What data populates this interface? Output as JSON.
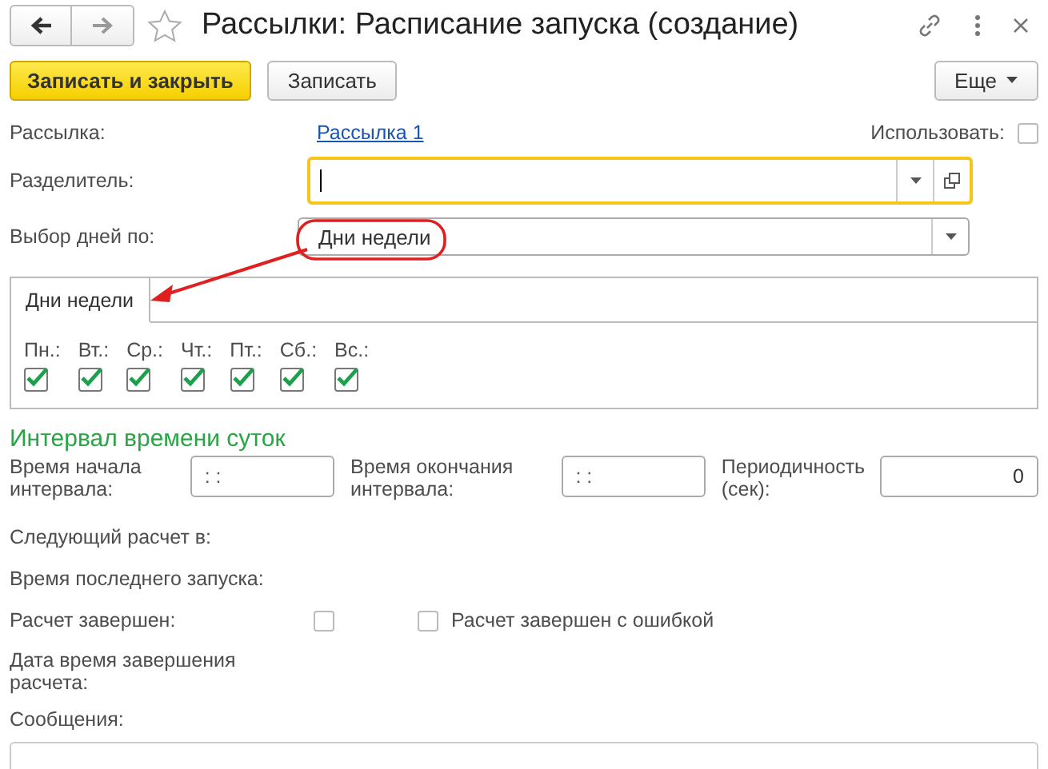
{
  "window": {
    "title": "Рассылки: Расписание запуска (создание)",
    "favorite": false
  },
  "toolbar": {
    "buttons": [
      {
        "label": "Записать и закрыть",
        "kind": "primary"
      },
      {
        "label": "Записать",
        "kind": "normal"
      }
    ],
    "more": "Еще"
  },
  "mailing": {
    "label": "Рассылка:",
    "link": "Рассылка 1",
    "use_label": "Использовать:",
    "use_checked": false
  },
  "separator": {
    "label": "Разделитель:",
    "focused": true
  },
  "days_by": {
    "label": "Выбор дней по:",
    "value": "Дни недели"
  },
  "tabs": [
    {
      "label": "Дни недели",
      "selected": true
    }
  ],
  "days": [
    {
      "label": "Пн.:",
      "checked": true
    },
    {
      "label": "Вт.:",
      "checked": true
    },
    {
      "label": "Ср.:",
      "checked": true
    },
    {
      "label": "Чт.:",
      "checked": true
    },
    {
      "label": "Пт.:",
      "checked": true
    },
    {
      "label": "Сб.:",
      "checked": true
    },
    {
      "label": "Вс.:",
      "checked": true
    }
  ],
  "interval": {
    "heading": "Интервал времени суток",
    "start_label": "Время начала интервала:",
    "start_value": ":  :",
    "end_label": "Время окончания интервала:",
    "end_value": ":  :",
    "period_label": "Периодичность (сек):",
    "period_value": "0"
  },
  "next_run_label": "Следующий расчет в:",
  "last_run_label": "Время последнего запуска:",
  "done": {
    "label": "Расчет завершен:",
    "checked": false,
    "error_label": "Расчет завершен с ошибкой",
    "error_checked": false
  },
  "end_date_label": "Дата время завершения расчета:",
  "messages_label": "Сообщения:"
}
